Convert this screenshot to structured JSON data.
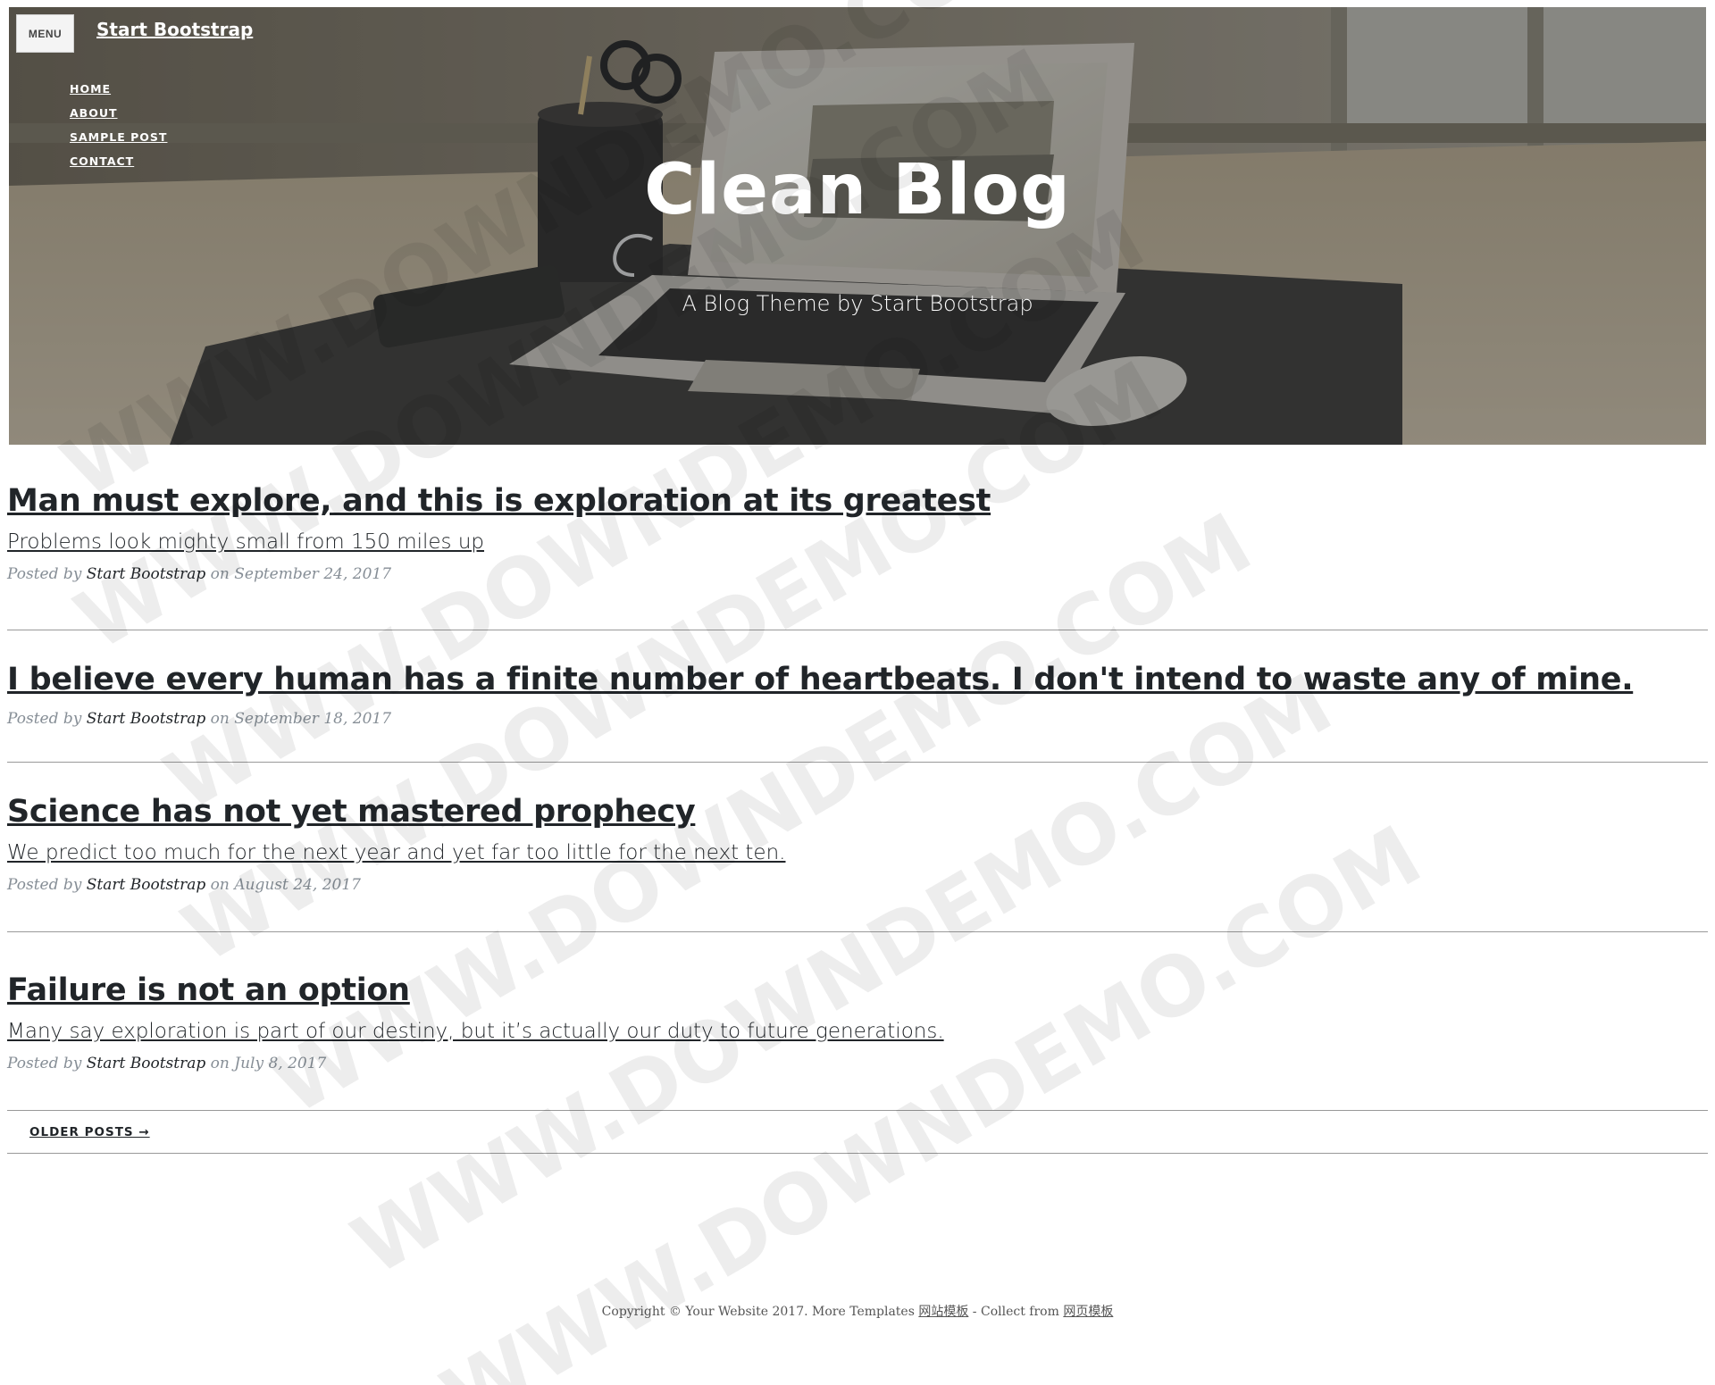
{
  "nav": {
    "menu_label": "MENU",
    "brand": "Start Bootstrap",
    "items": [
      {
        "label": "HOME"
      },
      {
        "label": "ABOUT"
      },
      {
        "label": "SAMPLE POST"
      },
      {
        "label": "CONTACT"
      }
    ]
  },
  "header": {
    "title": "Clean Blog",
    "subtitle": "A Blog Theme by Start Bootstrap"
  },
  "posts": [
    {
      "title": "Man must explore, and this is exploration at its greatest",
      "subtitle": "Problems look mighty small from 150 miles up",
      "meta_prefix": "Posted by ",
      "author": "Start Bootstrap",
      "meta_on": " on ",
      "date": "September 24, 2017"
    },
    {
      "title": "I believe every human has a finite number of heartbeats. I don't intend to waste any of mine.",
      "subtitle": "",
      "meta_prefix": "Posted by ",
      "author": "Start Bootstrap",
      "meta_on": " on ",
      "date": "September 18, 2017"
    },
    {
      "title": "Science has not yet mastered prophecy",
      "subtitle": "We predict too much for the next year and yet far too little for the next ten.",
      "meta_prefix": "Posted by ",
      "author": "Start Bootstrap",
      "meta_on": " on ",
      "date": "August 24, 2017"
    },
    {
      "title": "Failure is not an option",
      "subtitle": "Many say exploration is part of our destiny, but it’s actually our duty to future generations.",
      "meta_prefix": "Posted by ",
      "author": "Start Bootstrap",
      "meta_on": " on ",
      "date": "July 8, 2017"
    }
  ],
  "pager": {
    "older_label": "OLDER POSTS →"
  },
  "footer": {
    "copyright": "Copyright © Your Website 2017. More Templates ",
    "link1": "网站模板",
    "separator": " - Collect from ",
    "link2": "网页模板"
  },
  "watermark": {
    "text": "WWW.DOWNDEMO.COM"
  },
  "colors": {
    "text": "#212529",
    "meta": "#868e96",
    "divider": "#999999",
    "hero_overlay": "#212529"
  }
}
